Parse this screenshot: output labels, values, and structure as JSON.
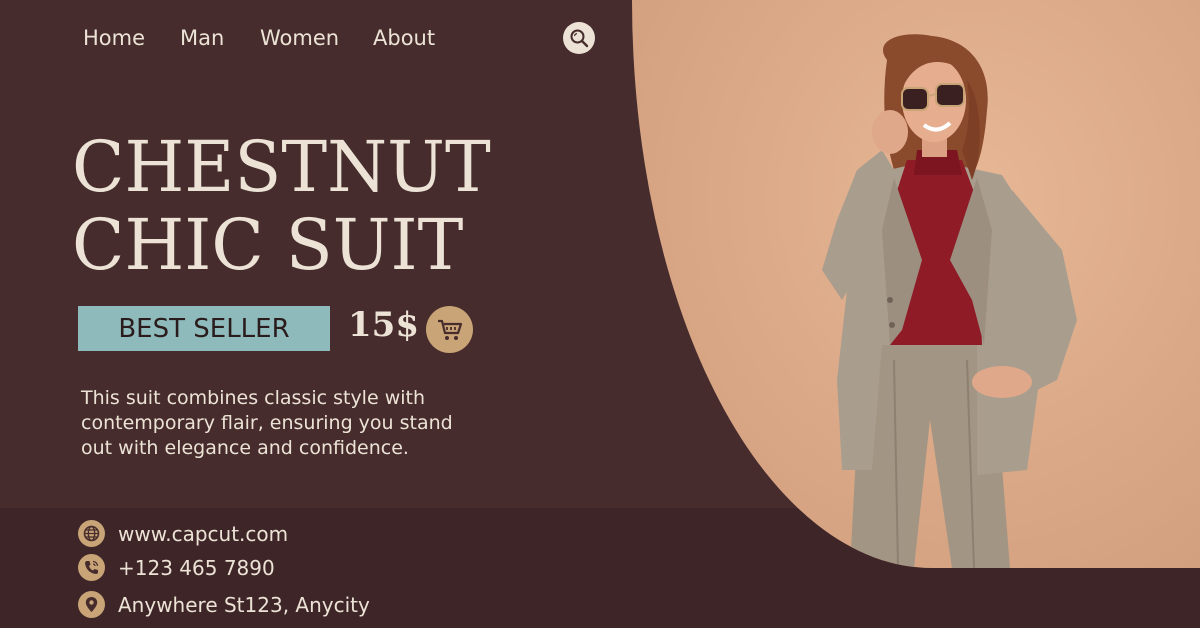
{
  "nav": {
    "items": [
      {
        "label": "Home"
      },
      {
        "label": "Man"
      },
      {
        "label": "Women"
      },
      {
        "label": "About"
      }
    ],
    "search_icon": "search-icon"
  },
  "hero": {
    "title_line1": "CHESTNUT",
    "title_line2": "CHIC SUIT",
    "badge": "BEST SELLER",
    "price": "15$",
    "cart_icon": "cart-icon",
    "description": "This suit combines classic style with contemporary flair, ensuring you stand out with elegance and confidence."
  },
  "contact": {
    "website": "www.capcut.com",
    "phone": "+123 465 7890",
    "address": "Anywhere St123, Anycity"
  },
  "colors": {
    "background": "#462c2c",
    "footer": "#3e2628",
    "text": "#ece3d6",
    "accent_gold": "#c9a476",
    "badge_teal": "#8fbabb",
    "photo_bg": "#dcaa88"
  }
}
